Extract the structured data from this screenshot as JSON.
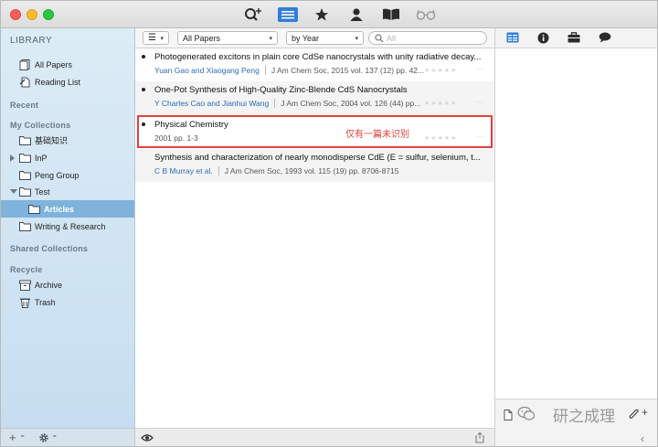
{
  "toolbar": {
    "icons": [
      "search-add-icon",
      "list-view-icon",
      "star-icon",
      "person-icon",
      "book-icon",
      "glasses-icon"
    ],
    "accent": "#2f7ed8"
  },
  "sidebar": {
    "library_heading": "LIBRARY",
    "library_items": [
      {
        "label": "All Papers",
        "icon": "papers-icon"
      },
      {
        "label": "Reading List",
        "icon": "reading-list-icon"
      }
    ],
    "recent_heading": "Recent",
    "collections_heading": "My Collections",
    "collections": [
      {
        "label": "基础知识",
        "icon": "folder-icon"
      },
      {
        "label": "InP",
        "icon": "folder-icon"
      },
      {
        "label": "Peng Group",
        "icon": "folder-icon"
      },
      {
        "label": "Test",
        "icon": "folder-icon"
      },
      {
        "label": "Articles",
        "icon": "folder-icon"
      },
      {
        "label": "Writing & Research",
        "icon": "folder-icon"
      }
    ],
    "shared_heading": "Shared Collections",
    "recycle_heading": "Recycle",
    "recycle_items": [
      {
        "label": "Archive",
        "icon": "archive-icon"
      },
      {
        "label": "Trash",
        "icon": "trash-icon"
      }
    ],
    "selected_color": "#7fb3dc"
  },
  "filter": {
    "view_menu": "☰",
    "scope": "All Papers",
    "sort": "by Year",
    "search_placeholder": "All"
  },
  "papers": [
    {
      "title": "Photogenerated excitons in plain core CdSe nanocrystals with unity radiative decay...",
      "authors": "Yuan Gao and Xiaogang Peng",
      "journal": "J Am Chem Soc, 2015 vol. 137 (12) pp. 42..."
    },
    {
      "title": "One-Pot Synthesis of High-Quality Zinc-Blende CdS Nanocrystals",
      "authors": "Y Charles Cao and Jianhui Wang",
      "journal": "J Am Chem Soc, 2004 vol. 126 (44) pp..."
    },
    {
      "title": "Physical Chemistry",
      "authors": "",
      "journal": "2001 pp. 1-3"
    },
    {
      "title": "Synthesis and characterization of nearly monodisperse CdE (E = sulfur, selenium, t...",
      "authors": "C B Murray et al.",
      "journal": "J Am Chem Soc, 1993 vol. 115 (19) pp. 8706-8715"
    }
  ],
  "stars": "★★★★★",
  "more": "···",
  "annotation": "仅有一篇未识别",
  "annotation_color": "#e0403a",
  "bottom": {
    "add": "+",
    "add_chev": "⌄",
    "gear_chev": "⌄",
    "watermark": "研之成理",
    "attach": "+"
  }
}
